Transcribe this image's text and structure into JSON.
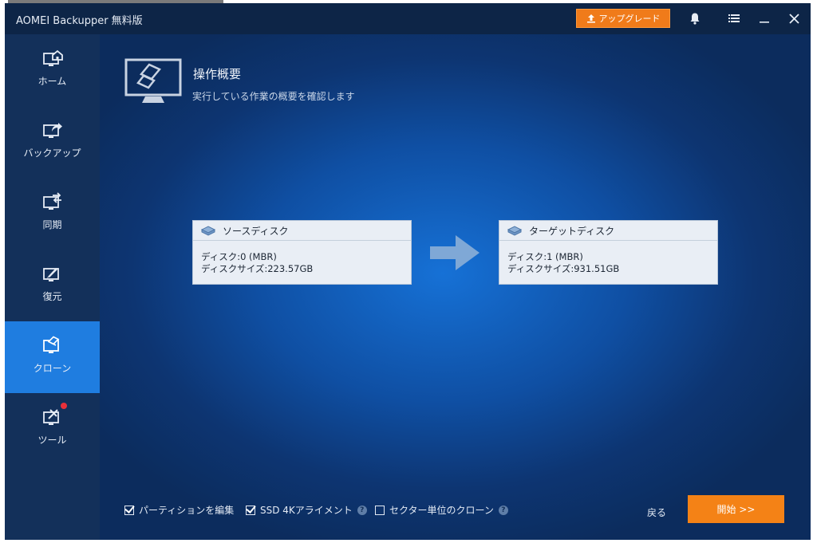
{
  "window": {
    "title": "AOMEI Backupper 無料版",
    "upgrade_label": "アップグレード"
  },
  "sidebar": {
    "items": [
      {
        "label": "ホーム",
        "icon": "home-monitor-icon"
      },
      {
        "label": "バックアップ",
        "icon": "backup-monitor-icon"
      },
      {
        "label": "同期",
        "icon": "sync-monitor-icon"
      },
      {
        "label": "復元",
        "icon": "restore-monitor-icon"
      },
      {
        "label": "クローン",
        "icon": "clone-monitor-icon",
        "active": true
      },
      {
        "label": "ツール",
        "icon": "tools-monitor-icon",
        "badge": true
      }
    ]
  },
  "header": {
    "title": "操作概要",
    "subtitle": "実行している作業の概要を確認します"
  },
  "source": {
    "title": "ソースディスク",
    "disk": "ディスク:0 (MBR)",
    "size": "ディスクサイズ:223.57GB"
  },
  "target": {
    "title": "ターゲットディスク",
    "disk": "ディスク:1 (MBR)",
    "size": "ディスクサイズ:931.51GB"
  },
  "options": {
    "edit_partitions": {
      "label": "パーティションを編集",
      "checked": true
    },
    "ssd_align": {
      "label": "SSD 4Kアライメント",
      "checked": true
    },
    "sector_clone": {
      "label": "セクター単位のクローン",
      "checked": false
    }
  },
  "footer": {
    "back_label": "戻る",
    "start_label": "開始 >>"
  },
  "colors": {
    "accent_orange": "#f48216",
    "active_nav": "#1f7de0",
    "sidebar_bg": "#13305a"
  }
}
